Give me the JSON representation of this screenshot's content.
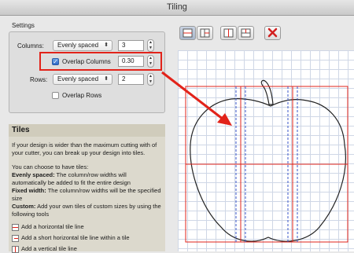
{
  "window": {
    "title": "Tiling"
  },
  "settings": {
    "group_label": "Settings",
    "columns": {
      "label": "Columns:",
      "mode": "Evenly spaced",
      "value": "3"
    },
    "overlap_columns": {
      "label": "Overlap Columns",
      "checked": true,
      "value": "0.30"
    },
    "rows": {
      "label": "Rows:",
      "mode": "Evenly spaced",
      "value": "2"
    },
    "overlap_rows": {
      "label": "Overlap Rows",
      "checked": false
    }
  },
  "tiles": {
    "title": "Tiles",
    "intro": "If your design is wider than the maximum cutting with of your cutter, you can break up your design into tiles.",
    "choose": "You can choose to have tiles:",
    "evenly_term": "Evenly spaced:",
    "evenly_desc": " The column/row widths will automatically be added to fit the entire design",
    "fixed_term": "Fixed width:",
    "fixed_desc": " The column/row widths will be the specified size",
    "custom_term": "Custom:",
    "custom_desc": " Add your own tiles of custom sizes by using the following tools",
    "tools": [
      "Add a horizontal tile line",
      "Add a short horizontal tile line within a tile",
      "Add a vertical tile line"
    ]
  },
  "toolbar": {
    "buttons": [
      "horizontal-tile-line-icon",
      "short-horizontal-tile-line-icon",
      "vertical-tile-line-icon",
      "short-vertical-tile-line-icon",
      "delete-icon"
    ]
  },
  "colors": {
    "accent_red": "#e2231a",
    "tile_line_blue": "#3a55c8",
    "grid": "#cfd7e6"
  }
}
